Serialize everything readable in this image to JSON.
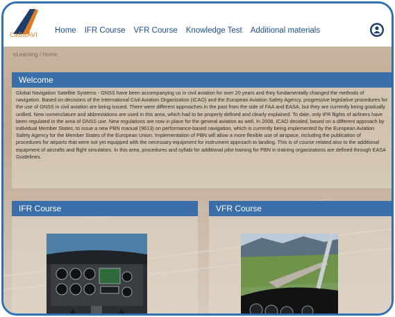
{
  "brand": {
    "logo_text": "CaBBAVI",
    "accent": "#e07b22"
  },
  "nav": {
    "items": [
      {
        "label": "Home"
      },
      {
        "label": "IFR Course"
      },
      {
        "label": "VFR Course"
      },
      {
        "label": "Knowledge Test"
      },
      {
        "label": "Additional materials"
      }
    ],
    "user_icon": "user-icon"
  },
  "breadcrumb": {
    "root": "eLearning",
    "separator": " / ",
    "current": "Home"
  },
  "welcome": {
    "title": "Welcome",
    "body": "Global Navigation Satellite Systems - GNSS have been accompanying us in civil aviation for over 20 years and they fundamentally changed the methods of navigation. Based on decisions of the International Civil Aviation Organization (ICAO) and the European Aviation Safety Agency, progressive legislative procedures for the use of GNSS in civil aviation are being issued. There were different approaches in the past from the side of FAA and EASA, but they are currently being gradually unified. New nomenclature and abbreviations are used in this area, which had to be properly defined and clearly explained. To date, only IFR flights of airliners have been regulated in the area of GNSS use. New regulations are now in place for the general aviation as well. In 2008, ICAO decided, based on a different approach by individual Member States, to issue a new PBN manual (9613) on performance-based navigation, which is currently being implemented by the European Aviation Safety Agency for the Member States of the European Union. Implementation of PBN will allow a more flexible use of airspace, including the publication of procedures for airports that were not yet equipped with the necessary equipment for instrument approach to landing. This is of course related also to the additional equipment of aircrafts and flight simulators. In this area, procedures and syllabi for additional pilot training for PBN in training organizations are defined through EASA Guidelines."
  },
  "cards": {
    "ifr": {
      "title": "IFR Course",
      "image": "cockpit-instrument-panel-photo"
    },
    "vfr": {
      "title": "VFR Course",
      "image": "cockpit-view-valley-photo"
    }
  },
  "colors": {
    "panel_header": "#3a6ea8",
    "nav_text": "#1b4f8c",
    "frame": "#2d6fb0"
  }
}
